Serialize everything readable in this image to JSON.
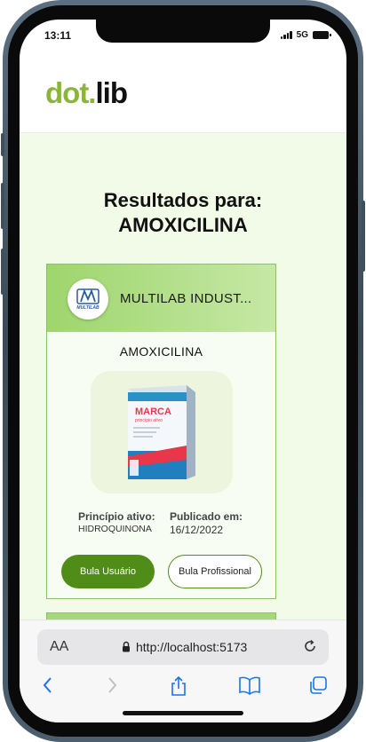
{
  "status_bar": {
    "time": "13:11",
    "network": "5G"
  },
  "header": {
    "logo_dot": "dot.",
    "logo_lib": "lib"
  },
  "results": {
    "title_line1": "Resultados para:",
    "title_line2": "AMOXICILINA"
  },
  "card": {
    "manufacturer": "MULTILAB INDUST...",
    "manufacturer_logo_text": "MULTILAB",
    "drug_name": "AMOXICILINA",
    "package_brand": "MARCA",
    "package_subtitle": "princípio ativo",
    "active_ingredient_label": "Princípio ativo:",
    "active_ingredient": "HIDROQUINONA",
    "published_label": "Publicado em:",
    "published_date": "16/12/2022",
    "btn_patient": "Bula Usuário",
    "btn_professional": "Bula Profissional"
  },
  "browser": {
    "text_size": "AA",
    "url": "http://localhost:5173"
  },
  "colors": {
    "brand_green": "#8ab43c",
    "button_green": "#4f8d18",
    "content_bg": "#f2fbe8"
  },
  "icons": [
    "lock-icon",
    "reload-icon",
    "back-icon",
    "forward-icon",
    "share-icon",
    "bookmarks-icon",
    "tabs-icon"
  ]
}
